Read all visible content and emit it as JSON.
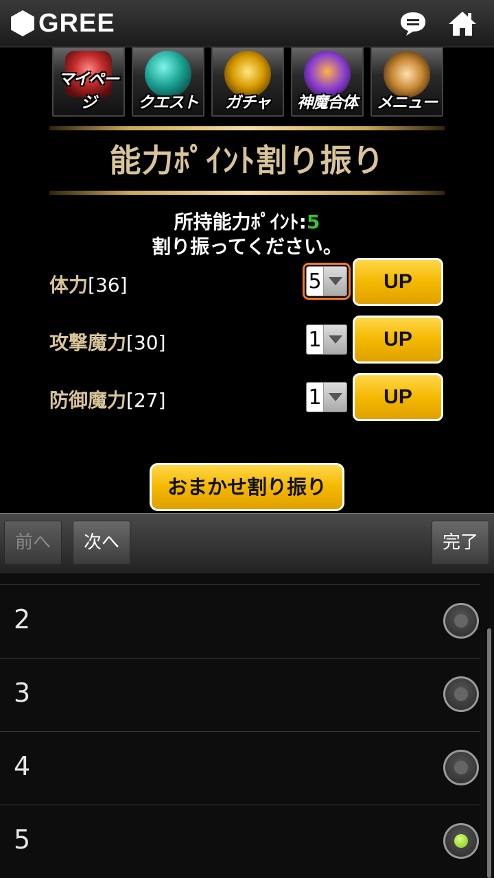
{
  "header": {
    "brand": "GREE",
    "icons": [
      "chat-bubble-icon",
      "home-icon"
    ]
  },
  "nav": {
    "items": [
      {
        "label": "マイページ",
        "icon": "mypage-emblem-icon"
      },
      {
        "label": "クエスト",
        "icon": "quest-emblem-icon"
      },
      {
        "label": "ガチャ",
        "icon": "gacha-emblem-icon"
      },
      {
        "label": "神魔合体",
        "icon": "fusion-emblem-icon"
      },
      {
        "label": "メニュー",
        "icon": "menu-emblem-icon"
      }
    ]
  },
  "page": {
    "title": "能力ﾎﾟｲﾝﾄ割り振り",
    "points_label": "所持能力ﾎﾟｲﾝﾄ:",
    "points_value": "5",
    "instruction": "割り振ってください。"
  },
  "stats": [
    {
      "name": "体力",
      "value": "[36]",
      "selected": "5",
      "button": "UP"
    },
    {
      "name": "攻撃魔力",
      "value": "[30]",
      "selected": "1",
      "button": "UP"
    },
    {
      "name": "防御魔力",
      "value": "[27]",
      "selected": "1",
      "button": "UP"
    }
  ],
  "auto_button": "おまかせ割り振り",
  "toolbar": {
    "prev": "前へ",
    "next": "次へ",
    "done": "完了"
  },
  "picker": {
    "options": [
      "2",
      "3",
      "4",
      "5"
    ],
    "selected": "5"
  },
  "colors": {
    "gold_text": "#d8c49a",
    "points_green": "#32c632",
    "button_yellow": "#f5b800",
    "focus_orange": "#ff7a1a",
    "radio_selected": "#7fc41a"
  }
}
